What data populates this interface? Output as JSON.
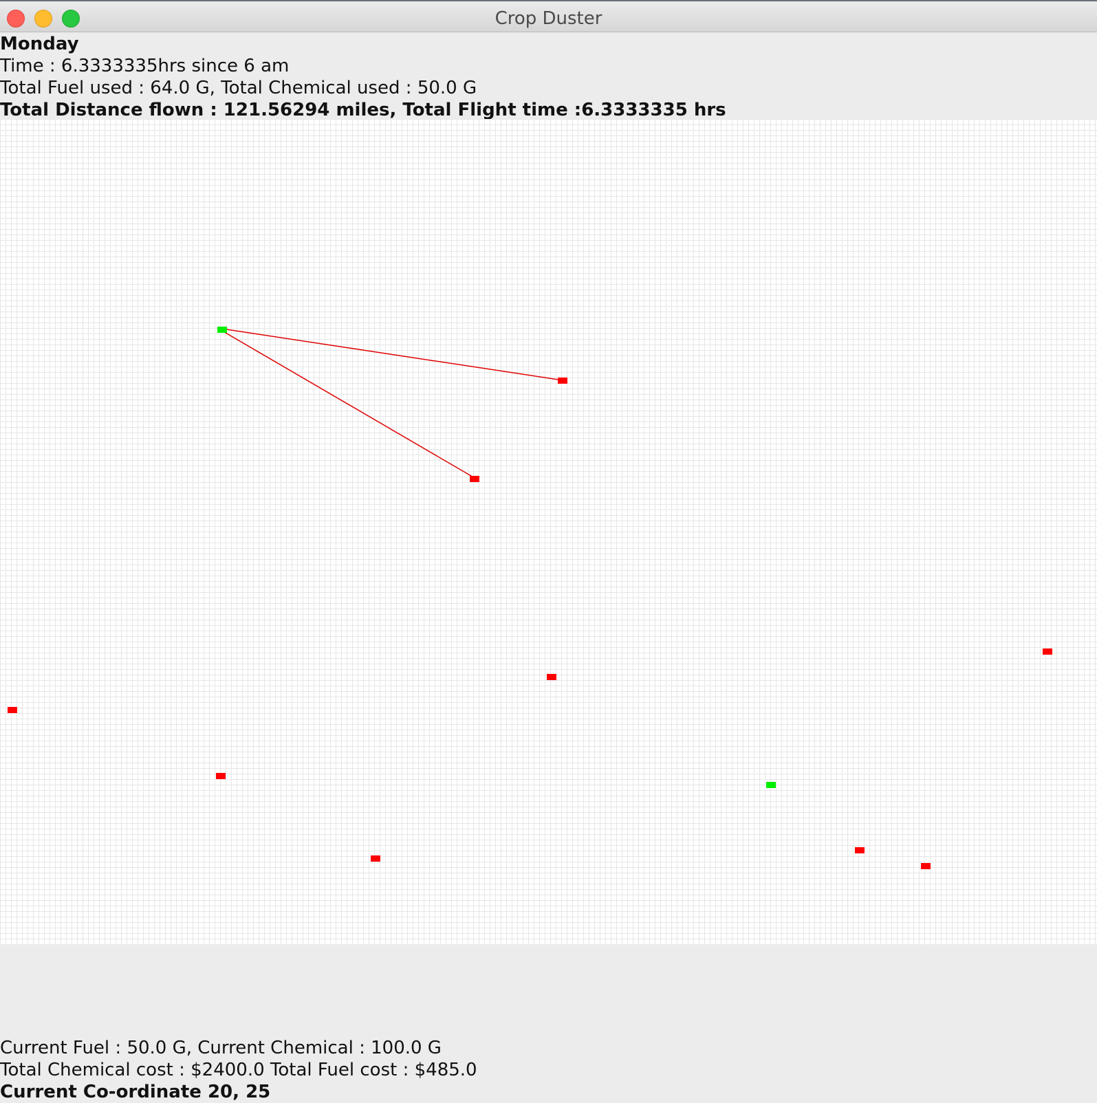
{
  "window": {
    "title": "Crop Duster"
  },
  "header": {
    "day": "Monday",
    "time": "Time : 6.3333335hrs since 6 am",
    "usage": "Total Fuel used : 64.0 G, Total Chemical used : 50.0 G",
    "distance": "Total Distance flown : 121.56294 miles, Total Flight time :6.3333335 hrs"
  },
  "footer": {
    "current": "Current Fuel : 50.0 G, Current Chemical : 100.0 G",
    "costs": "Total Chemical cost : $2400.0 Total Fuel cost : $485.0",
    "coordinate": "Current Co-ordinate 20, 25"
  },
  "colors": {
    "field": "#ff0000",
    "airport": "#00ee00",
    "route": "#e00000"
  }
}
